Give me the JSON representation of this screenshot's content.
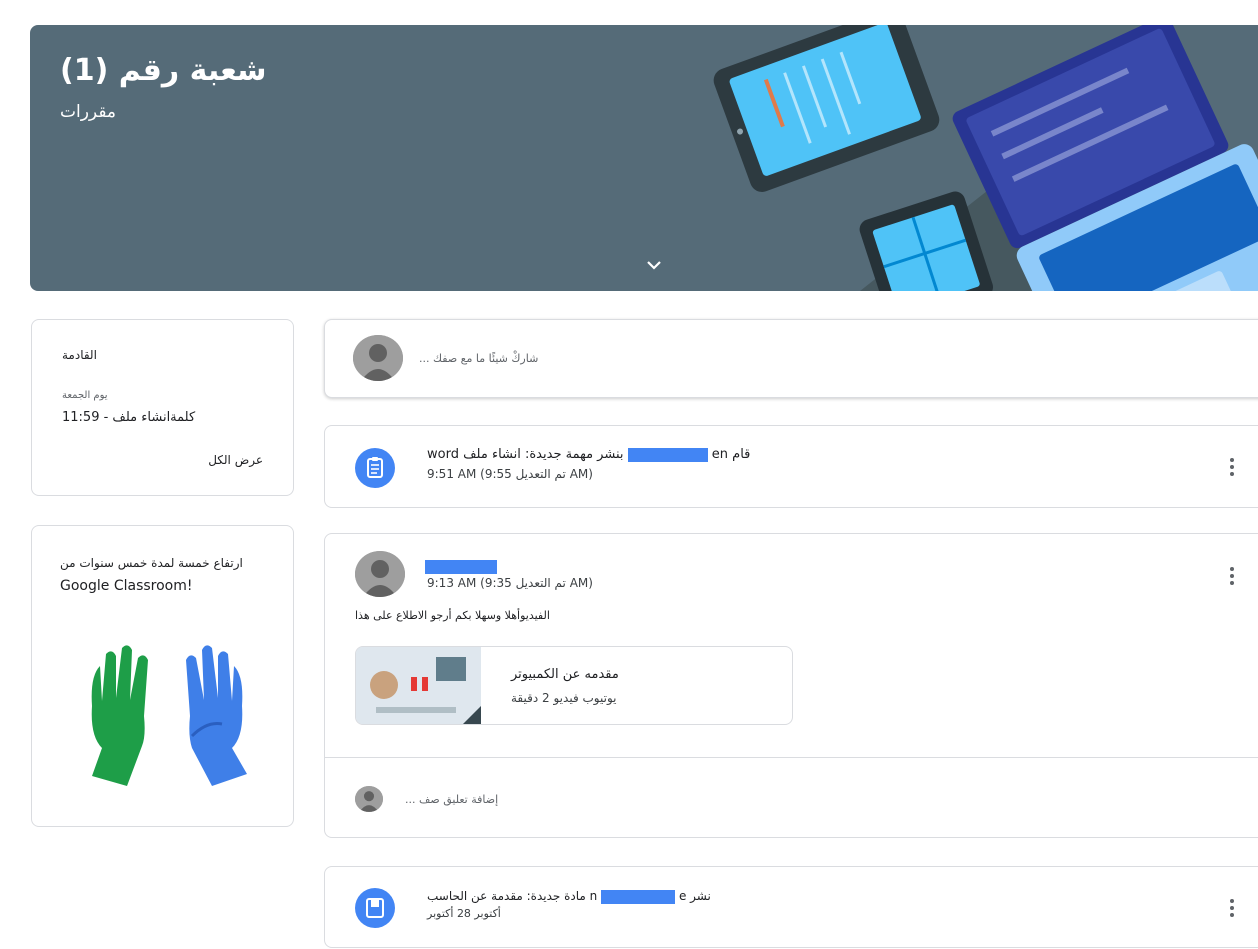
{
  "banner": {
    "title": "شعبة رقم (1)",
    "subtitle": "مقررات",
    "bg_color": "#556b78"
  },
  "upcoming": {
    "heading": "القادمة",
    "day": "يوم الجمعة",
    "item": "كلمةانشاء ملف - 11:59",
    "view_all": "عرض الكل"
  },
  "promo": {
    "line1": "ارتفاع خمسة لمدة خمس سنوات من",
    "line2": "Google Classroom!"
  },
  "share": {
    "placeholder": "... شاركْ شيئًا ما مع صفك"
  },
  "posts": [
    {
      "line1_end": "word بنشر مهمة جديدة: انشاء ملف",
      "line1_name_start": "en",
      "line1_prefix": "قام",
      "line2": "9:51 AM  (9:55 تم التعديل AM)",
      "icon": "assignment-icon"
    },
    {
      "time": "9:13 AM  (9:35 تم التعديل AM)",
      "body": "الفيديوأهلا وسهلا بكم أرجو الاطلاع على هذا",
      "attachment_title": "مقدمه عن الكمبيوتر",
      "attachment_sub": "يوتيوب فيديو 2 دقيقة",
      "comment_placeholder": "... إضافة تعليق صف"
    },
    {
      "line1_end": "مادة جديدة: مقدمة عن الحاسب",
      "line1_name_end": "n",
      "line1_name_start": "e",
      "line1_suffix": "نشر",
      "line2": "أكتوبر 28 أكتوبر",
      "icon": "material-icon"
    }
  ],
  "colors": {
    "accent": "#4285f4",
    "green_hand": "#1e9e48",
    "blue_hand": "#3f7fe8"
  }
}
